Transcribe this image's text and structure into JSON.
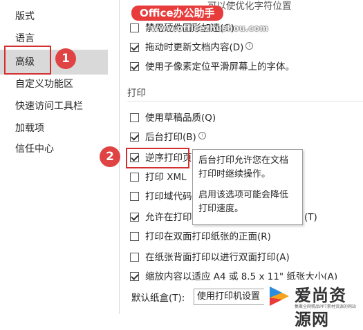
{
  "sidebar": {
    "items": [
      {
        "label": "版式"
      },
      {
        "label": "语言"
      },
      {
        "label": "高级"
      },
      {
        "label": "自定义功能区"
      },
      {
        "label": "快速访问工具栏"
      },
      {
        "label": "加载项"
      },
      {
        "label": "信任中心"
      }
    ],
    "active_index": 2
  },
  "badges": [
    "1",
    "2"
  ],
  "watermark": {
    "brand": "Office办公助手",
    "url": "www.officezhushou.com"
  },
  "top_partial_text": "可以使优化字符位置",
  "top_options": [
    {
      "label": "禁用硬件图形加速(G)",
      "checked": false
    },
    {
      "label": "拖动时更新文档内容(D)",
      "checked": true,
      "info": true
    },
    {
      "label": "使用子像素定位平滑屏幕上的字体。",
      "checked": true
    }
  ],
  "print_section": {
    "title": "打印",
    "options": [
      {
        "label": "使用草稿品质(Q)",
        "checked": false
      },
      {
        "label": "后台打印(B)",
        "checked": true,
        "info": true
      },
      {
        "label": "逆序打印页",
        "checked": true
      },
      {
        "label": "打印 XML",
        "checked": false
      },
      {
        "label": "打印域代码",
        "checked": false
      },
      {
        "label": "允许在打印",
        "checked": true,
        "suffix": "(T)"
      },
      {
        "label": "打印在双面打印纸张的正面(R)",
        "checked": false
      },
      {
        "label": "在纸张背面打印以进行双面打印(A)",
        "checked": false
      },
      {
        "label": "缩放内容以适应 A4 或 8.5 x 11\" 纸张大小(A)",
        "checked": true
      }
    ]
  },
  "tooltip": {
    "title": "后台打印",
    "line1": "后台打印允许您在文档打印时继续操作。",
    "line2": "启用该选项可能会降低打印速度。"
  },
  "tray": {
    "label": "默认纸盒(T):",
    "value": "使用打印机设置"
  },
  "logo": {
    "name": "爱尚资源网",
    "sub": "集聚全网精品PPT素材资源的网站"
  },
  "colors": {
    "badge": "#e04343",
    "highlight_border": "#d32f2f",
    "active_item_bg": "#d9d9d9"
  }
}
